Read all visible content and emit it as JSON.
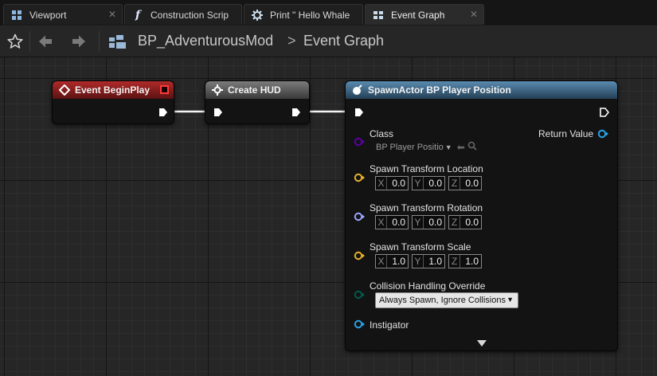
{
  "tabs": [
    {
      "label": "Viewport",
      "icon": "viewport-icon"
    },
    {
      "label": "Construction Scrip",
      "icon": "function-icon"
    },
    {
      "label": "Print \" Hello Whale",
      "icon": "gear-icon"
    },
    {
      "label": "Event Graph",
      "icon": "graph-icon"
    }
  ],
  "toolbar": {
    "blueprint_name": "BP_AdventurousMod",
    "separator": ">",
    "graph_name": "Event Graph"
  },
  "nodes": {
    "begin_play": {
      "title": "Event BeginPlay"
    },
    "create_hud": {
      "title": "Create HUD"
    },
    "spawn_actor": {
      "title": "SpawnActor BP Player Position",
      "class_label": "Class",
      "class_value": "BP Player Positio",
      "return_label": "Return Value",
      "location": {
        "label": "Spawn Transform Location",
        "x": "0.0",
        "y": "0.0",
        "z": "0.0"
      },
      "rotation": {
        "label": "Spawn Transform Rotation",
        "x": "0.0",
        "y": "0.0",
        "z": "0.0"
      },
      "scale": {
        "label": "Spawn Transform Scale",
        "x": "1.0",
        "y": "1.0",
        "z": "1.0"
      },
      "collision": {
        "label": "Collision Handling Override",
        "value": "Always Spawn, Ignore Collisions"
      },
      "instigator": {
        "label": "Instigator"
      },
      "axis_x": "X",
      "axis_y": "Y",
      "axis_z": "Z"
    }
  },
  "colors": {
    "exec": "#ffffff",
    "class_pin": "#5b00a8",
    "vector_pin": "#e8b12c",
    "rotator_pin": "#9aa6ff",
    "enum_pin": "#005a4c",
    "object_pin": "#2aa2e8"
  }
}
